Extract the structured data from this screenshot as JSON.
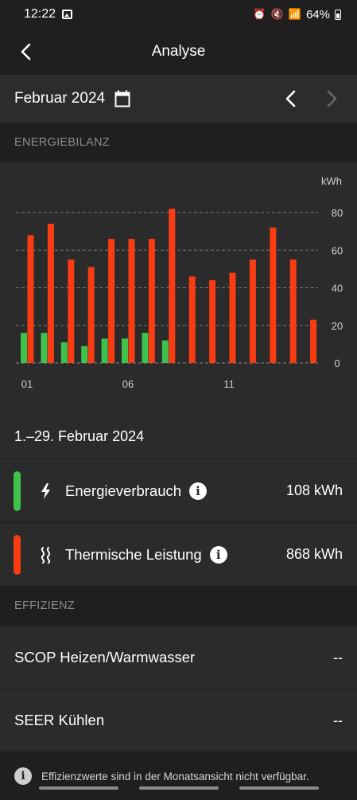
{
  "status": {
    "time": "12:22",
    "battery": "64%"
  },
  "header": {
    "title": "Analyse"
  },
  "month": {
    "label": "Februar 2024"
  },
  "sections": {
    "balance": "ENERGIEBILANZ",
    "efficiency": "EFFIZIENZ"
  },
  "chart_data": {
    "type": "bar",
    "unit": "kWh",
    "categories": [
      "01",
      "02",
      "03",
      "04",
      "05",
      "06",
      "07",
      "08",
      "09",
      "10",
      "11",
      "12",
      "13",
      "14",
      "15"
    ],
    "x_tick_labels": [
      "01",
      "06",
      "11"
    ],
    "y_ticks": [
      0,
      20,
      40,
      60,
      80
    ],
    "ylim": [
      0,
      85
    ],
    "series": [
      {
        "key": "energy",
        "values": [
          16,
          16,
          11,
          9,
          13,
          13,
          16,
          12,
          0,
          0,
          0,
          0,
          0,
          0,
          0
        ],
        "color": "#3fc24c"
      },
      {
        "key": "thermal",
        "values": [
          68,
          74,
          55,
          51,
          66,
          66,
          66,
          82,
          46,
          44,
          48,
          55,
          72,
          55,
          23
        ],
        "color": "#fa3c12"
      }
    ],
    "grid": true
  },
  "summary": {
    "period": "1.–29. Februar 2024",
    "energy": {
      "label": "Energieverbrauch",
      "value": "108 kWh",
      "color": "#3fc24c"
    },
    "thermal": {
      "label": "Thermische Leistung",
      "value": "868 kWh",
      "color": "#fa3c12"
    }
  },
  "efficiency": {
    "scop": {
      "label": "SCOP Heizen/Warmwasser",
      "value": "--"
    },
    "seer": {
      "label": "SEER Kühlen",
      "value": "--"
    }
  },
  "note": "Effizienzwerte sind in der Monatsansicht nicht verfügbar.",
  "icons": {
    "back": "chevron-left-icon",
    "calendar": "calendar-icon",
    "info": "info-icon",
    "bolt": "lightning-icon",
    "heat": "heat-waves-icon"
  }
}
